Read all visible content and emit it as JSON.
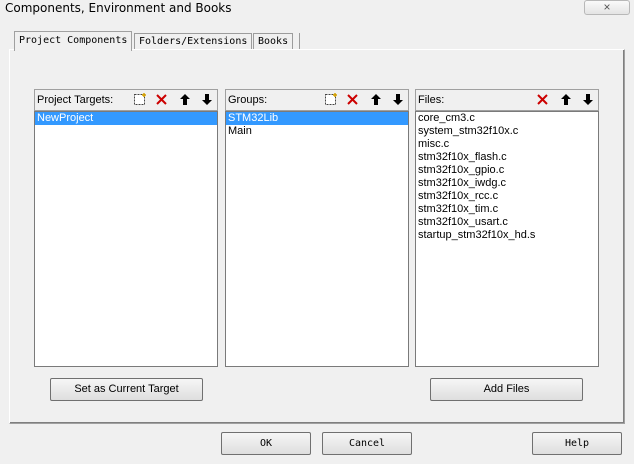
{
  "window": {
    "title": "Components, Environment and Books",
    "close_glyph": "×"
  },
  "tabs": [
    {
      "label": "Project Components"
    },
    {
      "label": "Folders/Extensions"
    },
    {
      "label": "Books"
    }
  ],
  "targets": {
    "label": "Project Targets:",
    "items": [
      "NewProject"
    ]
  },
  "groups": {
    "label": "Groups:",
    "items": [
      "STM32Lib",
      "Main"
    ]
  },
  "files": {
    "label": "Files:",
    "items": [
      "core_cm3.c",
      "system_stm32f10x.c",
      "misc.c",
      "stm32f10x_flash.c",
      "stm32f10x_gpio.c",
      "stm32f10x_iwdg.c",
      "stm32f10x_rcc.c",
      "stm32f10x_tim.c",
      "stm32f10x_usart.c",
      "startup_stm32f10x_hd.s"
    ]
  },
  "buttons": {
    "set_current_target": "Set as Current Target",
    "add_files": "Add Files",
    "ok": "OK",
    "cancel": "Cancel",
    "help": "Help"
  },
  "toolbar_icons": {
    "new": "new-item-icon",
    "delete": "delete-icon",
    "up": "move-up-icon",
    "down": "move-down-icon"
  },
  "colors": {
    "selection": "#3399ff",
    "delete": "#cc0000",
    "background": "#f0f0f0"
  }
}
